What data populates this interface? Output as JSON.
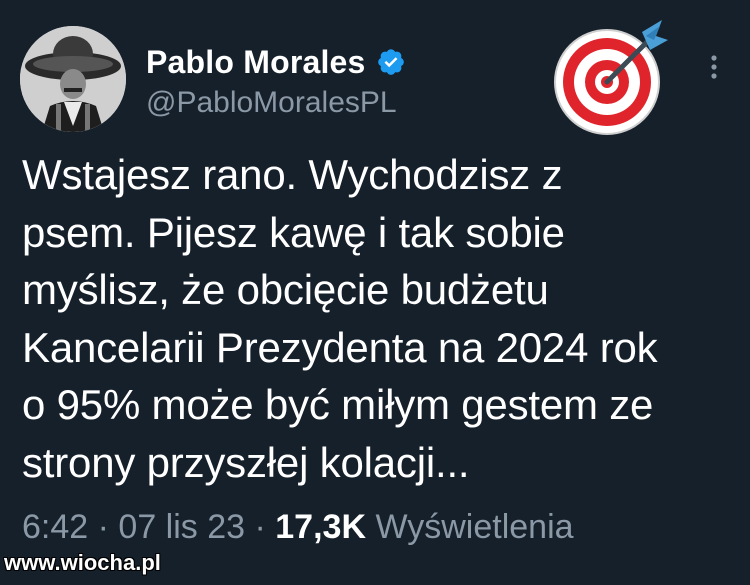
{
  "author": {
    "display_name": "Pablo Morales",
    "handle": "@PabloMoralesPL",
    "verified_color": "#1d9bf0"
  },
  "badge_emoji": "bullseye-dart",
  "tweet": {
    "text": "Wstajesz rano. Wychodzisz z\npsem. Pijesz kawę i tak sobie\nmyślisz, że obcięcie budżetu\nKancelarii Prezydenta na 2024 rok\no 95% może być miłym gestem ze\nstrony przyszłej kolacji..."
  },
  "meta": {
    "time": "6:42",
    "sep1": " · ",
    "date": "07 lis 23",
    "sep2": " · ",
    "views_count": "17,3K",
    "views_label": " Wyświetlenia"
  },
  "watermark": "www.wiocha.pl",
  "colors": {
    "background": "#15202b",
    "secondary_text": "#8b98a5",
    "primary_text": "#ffffff"
  }
}
